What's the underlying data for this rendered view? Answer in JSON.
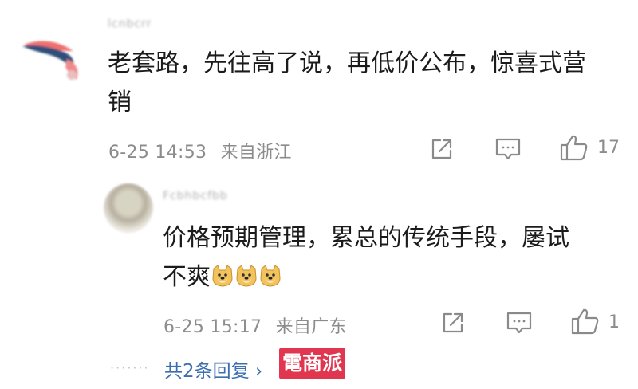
{
  "comment": {
    "username": "lcnbcrr",
    "text_line1": "老套路，先往高了说，再低价公布，惊喜式营",
    "text_line2": "销",
    "date": "6-25 14:53",
    "location": "来自浙江",
    "like_count": "17"
  },
  "reply": {
    "username": "Fcbhbcfbb",
    "text_line1": "价格预期管理，累总的传统手段，屡试",
    "text_line2": "不爽",
    "date": "6-25 15:17",
    "location": "来自广东",
    "like_count": "1"
  },
  "more_replies": {
    "dots": "·······",
    "label": "共2条回复",
    "chevron": "›"
  },
  "watermark": "電商派",
  "icons": {
    "share": "share-icon",
    "comment": "comment-icon",
    "like": "thumbs-up-icon",
    "emoji": "doge-emoji"
  }
}
